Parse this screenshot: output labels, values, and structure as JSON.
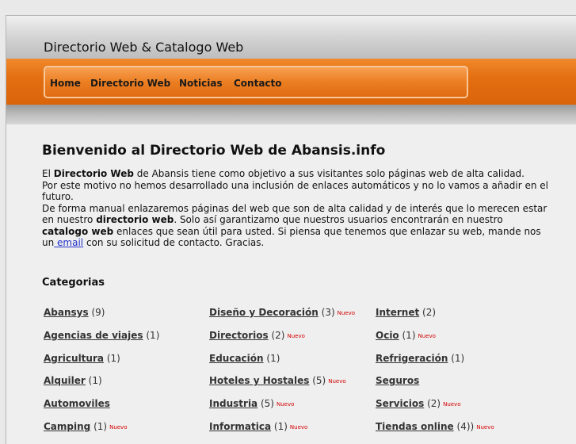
{
  "site": {
    "title": "Directorio Web & Catalogo Web"
  },
  "nav": [
    "Home",
    "Directorio Web",
    "Noticias",
    "Contacto"
  ],
  "welcome": {
    "heading": "Bienvenido al Directorio Web de Abansis.info",
    "p1_a": "El ",
    "p1_b": "Directorio Web",
    "p1_c": " de Abansis tiene como objetivo a sus visitantes solo páginas web de alta calidad.",
    "p2": "Por este motivo no hemos desarrollado una inclusión de enlaces automáticos y no lo vamos a añadir en el futuro.",
    "p3_a": "De forma manual enlazaremos páginas del web que son de alta calidad y de interés que lo merecen estar en nuestro ",
    "p3_b": "directorio web",
    "p3_c": ". Solo así garantizamo que nuestros usuarios encontrarán en nuestro ",
    "p3_d": "catalogo web",
    "p3_e": " enlaces que sean útil para usted. Si piensa que tenemos que enlazar su web, mande nos un",
    "email_link": " email",
    "p3_f": " con su solicitud de contacto. Gracias."
  },
  "categories": {
    "heading": "Categorias",
    "new_label": "Nuevo",
    "columns": [
      [
        {
          "name": "Abansys",
          "count": "(9)",
          "nuevo": false
        },
        {
          "name": "Agencias de viajes",
          "count": "(1)",
          "nuevo": false
        },
        {
          "name": "Agricultura",
          "count": "(1)",
          "nuevo": false
        },
        {
          "name": "Alquiler",
          "count": "(1)",
          "nuevo": false
        },
        {
          "name": "Automoviles",
          "count": "",
          "nuevo": false
        },
        {
          "name": "Camping",
          "count": "(1)",
          "nuevo": true
        }
      ],
      [
        {
          "name": "Diseño y Decoración",
          "count": "(3)",
          "nuevo": true
        },
        {
          "name": "Directorios",
          "count": "(2)",
          "nuevo": true
        },
        {
          "name": "Educación",
          "count": "(1)",
          "nuevo": false
        },
        {
          "name": "Hoteles y Hostales",
          "count": "(5)",
          "nuevo": true
        },
        {
          "name": "Industria",
          "count": "(5)",
          "nuevo": true
        },
        {
          "name": "Informatica",
          "count": "(1)",
          "nuevo": true
        }
      ],
      [
        {
          "name": "Internet",
          "count": "(2)",
          "nuevo": false
        },
        {
          "name": "Ocio",
          "count": "(1)",
          "nuevo": true
        },
        {
          "name": "Refrigeración",
          "count": "(1)",
          "nuevo": false
        },
        {
          "name": "Seguros",
          "count": "",
          "nuevo": false
        },
        {
          "name": "Servicios",
          "count": "(2)",
          "nuevo": true
        },
        {
          "name": "Tiendas online",
          "count": "(4))",
          "nuevo": true
        }
      ]
    ]
  }
}
